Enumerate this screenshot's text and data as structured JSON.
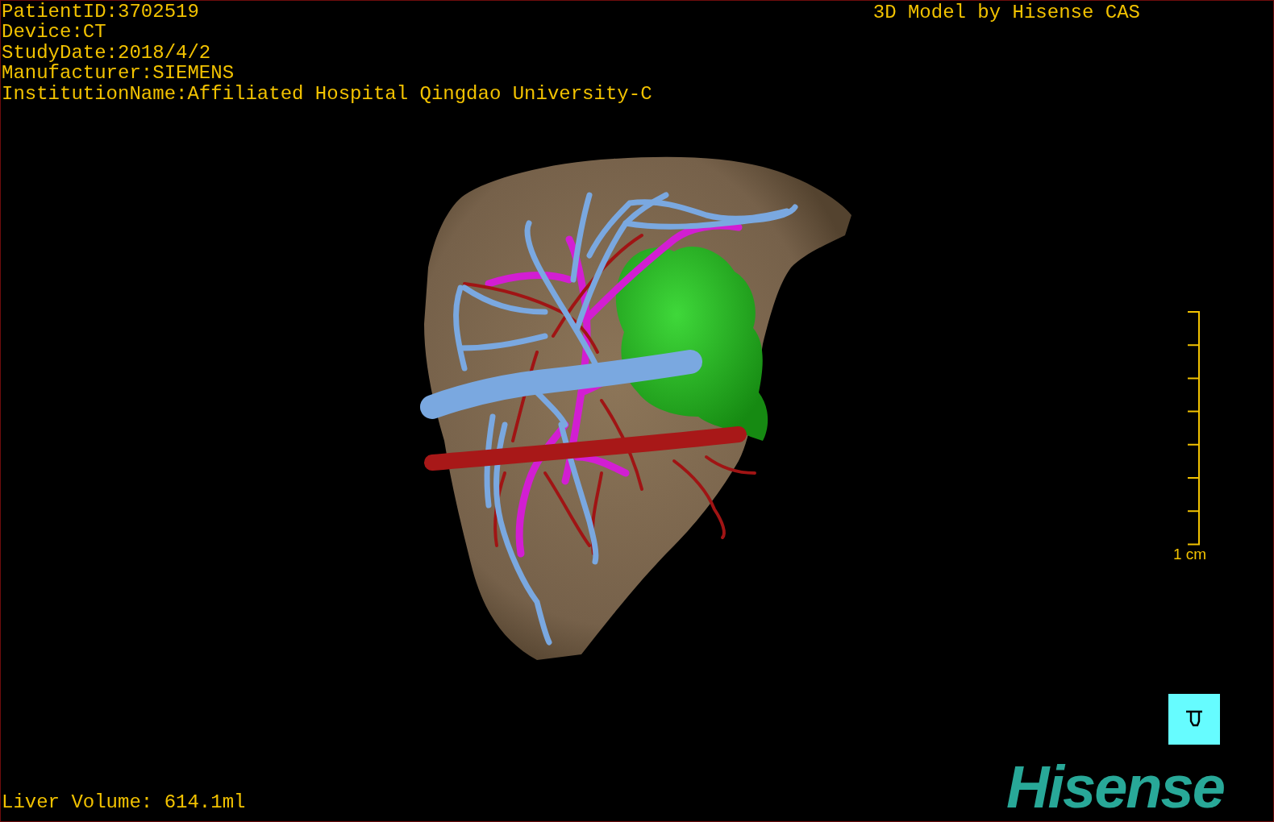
{
  "info_lines": [
    "PatientID:3702519",
    "Device:CT",
    "StudyDate:2018/4/2",
    "Manufacturer:SIEMENS",
    "InstitutionName:Affiliated Hospital Qingdao University-C"
  ],
  "title": "3D Model by Hisense CAS",
  "scale_bar": {
    "label": "1 cm"
  },
  "liver_volume": "Liver Volume: 614.1ml",
  "logo": "Hisense"
}
